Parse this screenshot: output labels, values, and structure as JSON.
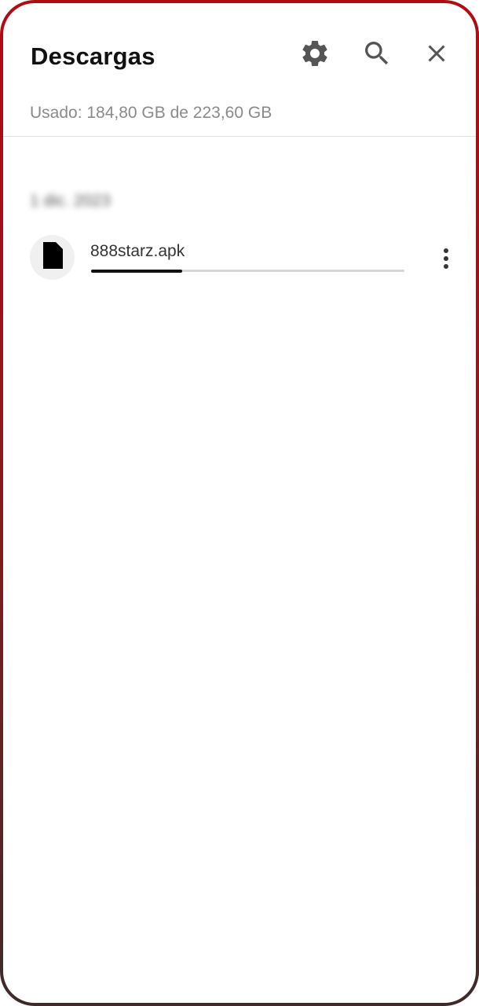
{
  "header": {
    "title": "Descargas",
    "settings_icon": "gear-icon",
    "search_icon": "search-icon",
    "close_icon": "close-icon"
  },
  "storage": {
    "usage_text": "Usado: 184,80 GB de 223,60 GB"
  },
  "downloads": {
    "date_header": "1 dic. 2023",
    "items": [
      {
        "file_name": "888starz.apk",
        "icon": "file-icon",
        "progress": 0.29,
        "menu_icon": "more-vert-icon"
      }
    ]
  },
  "colors": {
    "frame_top": "#b00c14",
    "frame_bottom": "#3e2a2a",
    "icon_gray": "#555555",
    "progress_fill": "#111111",
    "progress_track": "#d6d6d6"
  }
}
